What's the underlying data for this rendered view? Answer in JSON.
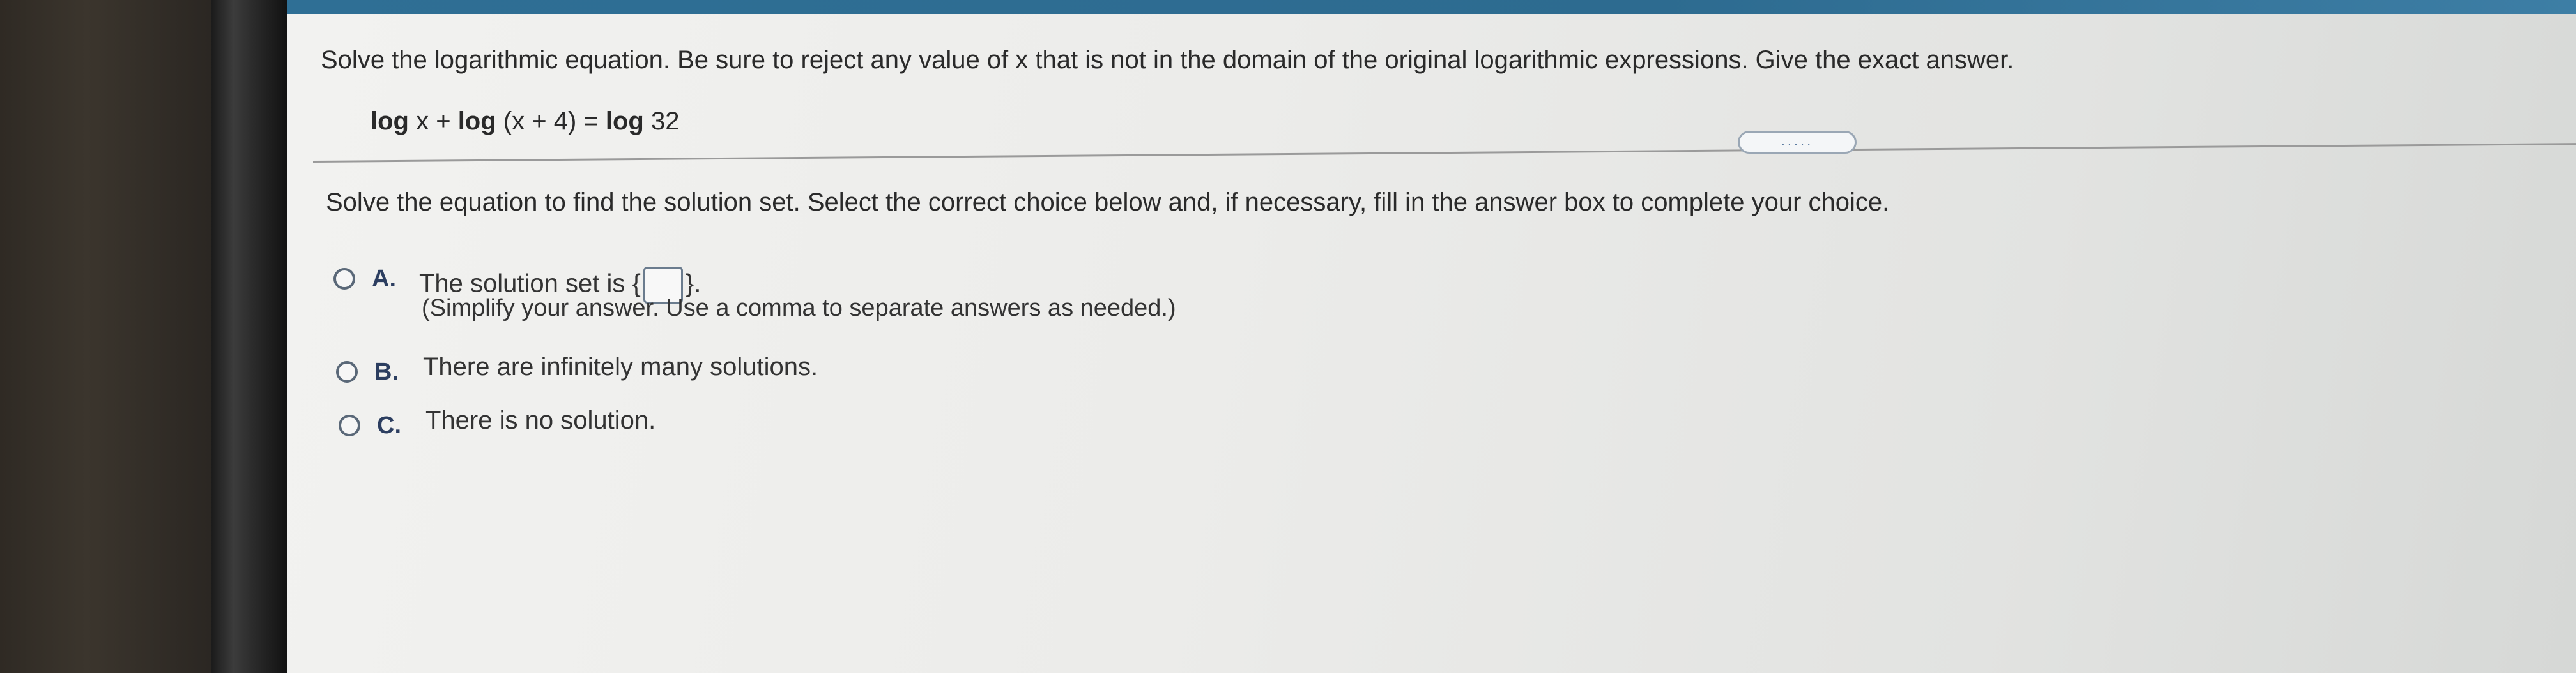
{
  "question": {
    "text": "Solve the logarithmic equation. Be sure to reject any value of x that is not in the domain of the original logarithmic expressions. Give the exact answer."
  },
  "equation": {
    "log1": "log",
    "var1": " x + ",
    "log2": "log",
    "arg2": " (x + 4) = ",
    "log3": "log",
    "rhs": " 32"
  },
  "more_button": {
    "label": "....."
  },
  "instruction": {
    "text": "Solve the equation to find the solution set. Select the correct choice below and, if necessary, fill in the answer box to complete your choice."
  },
  "choices": [
    {
      "letter": "A.",
      "text_before": "The solution set is ",
      "brace_open": "{",
      "brace_close": "}",
      "text_after": ".",
      "hint": "(Simplify your answer.  Use a comma to separate answers as needed.)"
    },
    {
      "letter": "B.",
      "text": "There are infinitely many solutions."
    },
    {
      "letter": "C.",
      "text": "There is no solution."
    }
  ],
  "answer_box": {
    "value": ""
  },
  "colors": {
    "topbar": "#2f6f95",
    "choice_letter": "#2c3e60",
    "radio_border": "#5a6878"
  }
}
